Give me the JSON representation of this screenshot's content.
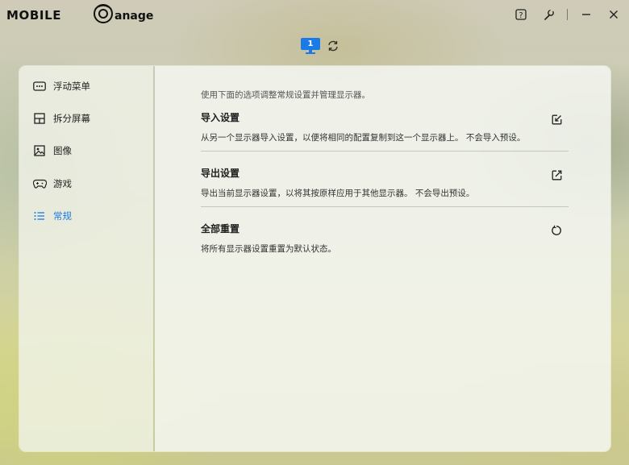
{
  "app": {
    "title": "MOBILE Manager",
    "logo_prefix": "MOBILE",
    "logo_suffix": "anager"
  },
  "titlebar": {
    "icons": [
      "help-icon",
      "settings-wrench-icon",
      "minimize-icon",
      "close-icon"
    ]
  },
  "monitors": {
    "active_label": "1"
  },
  "sidebar": {
    "items": [
      {
        "label": "浮动菜单",
        "icon": "floating-menu-icon",
        "active": false
      },
      {
        "label": "拆分屏幕",
        "icon": "split-screen-icon",
        "active": false
      },
      {
        "label": "图像",
        "icon": "image-icon",
        "active": false
      },
      {
        "label": "游戏",
        "icon": "gamepad-icon",
        "active": false
      },
      {
        "label": "常规",
        "icon": "list-icon",
        "active": true
      }
    ]
  },
  "content": {
    "intro": "使用下面的选项调整常规设置并管理显示器。",
    "sections": [
      {
        "title": "导入设置",
        "desc": "从另一个显示器导入设置，以便将相同的配置复制到这一个显示器上。 不会导入预设。",
        "icon": "import-icon"
      },
      {
        "title": "导出设置",
        "desc": "导出当前显示器设置，以将其按原样应用于其他显示器。 不会导出预设。",
        "icon": "export-icon"
      },
      {
        "title": "全部重置",
        "desc": "将所有显示器设置重置为默认状态。",
        "icon": "reset-icon"
      }
    ]
  },
  "colors": {
    "accent": "#1a7ae8"
  }
}
